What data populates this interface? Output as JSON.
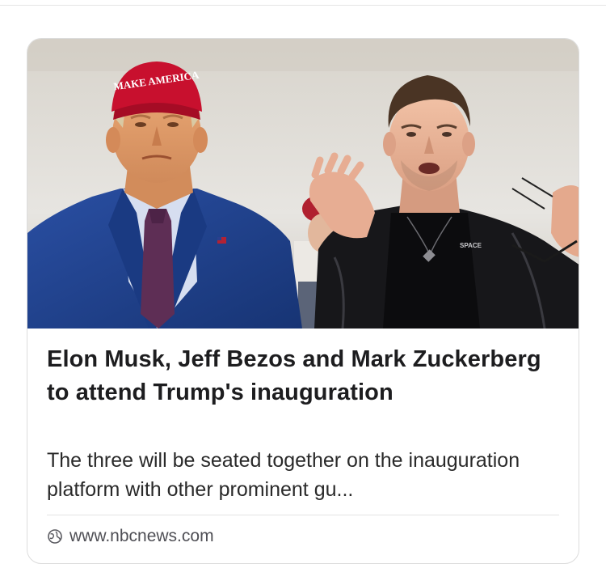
{
  "article": {
    "headline": "Elon Musk, Jeff Bezos and Mark Zuckerberg to attend Trump's inauguration",
    "snippet": "The three will be seated together on the inauguration platform with other prominent gu...",
    "source_url": "www.nbcnews.com",
    "source_icon": "globe-icon",
    "image": {
      "cap_text": "MAKE AMERICA",
      "shirt_text": "SPACE"
    }
  },
  "colors": {
    "headline": "#1d1d1f",
    "snippet": "#2a2a2a",
    "source": "#4f4f55",
    "cap_red": "#c8102e",
    "suit_navy": "#1f3e8a",
    "tie_purple": "#5e2e55",
    "jacket_black": "#17171a"
  }
}
